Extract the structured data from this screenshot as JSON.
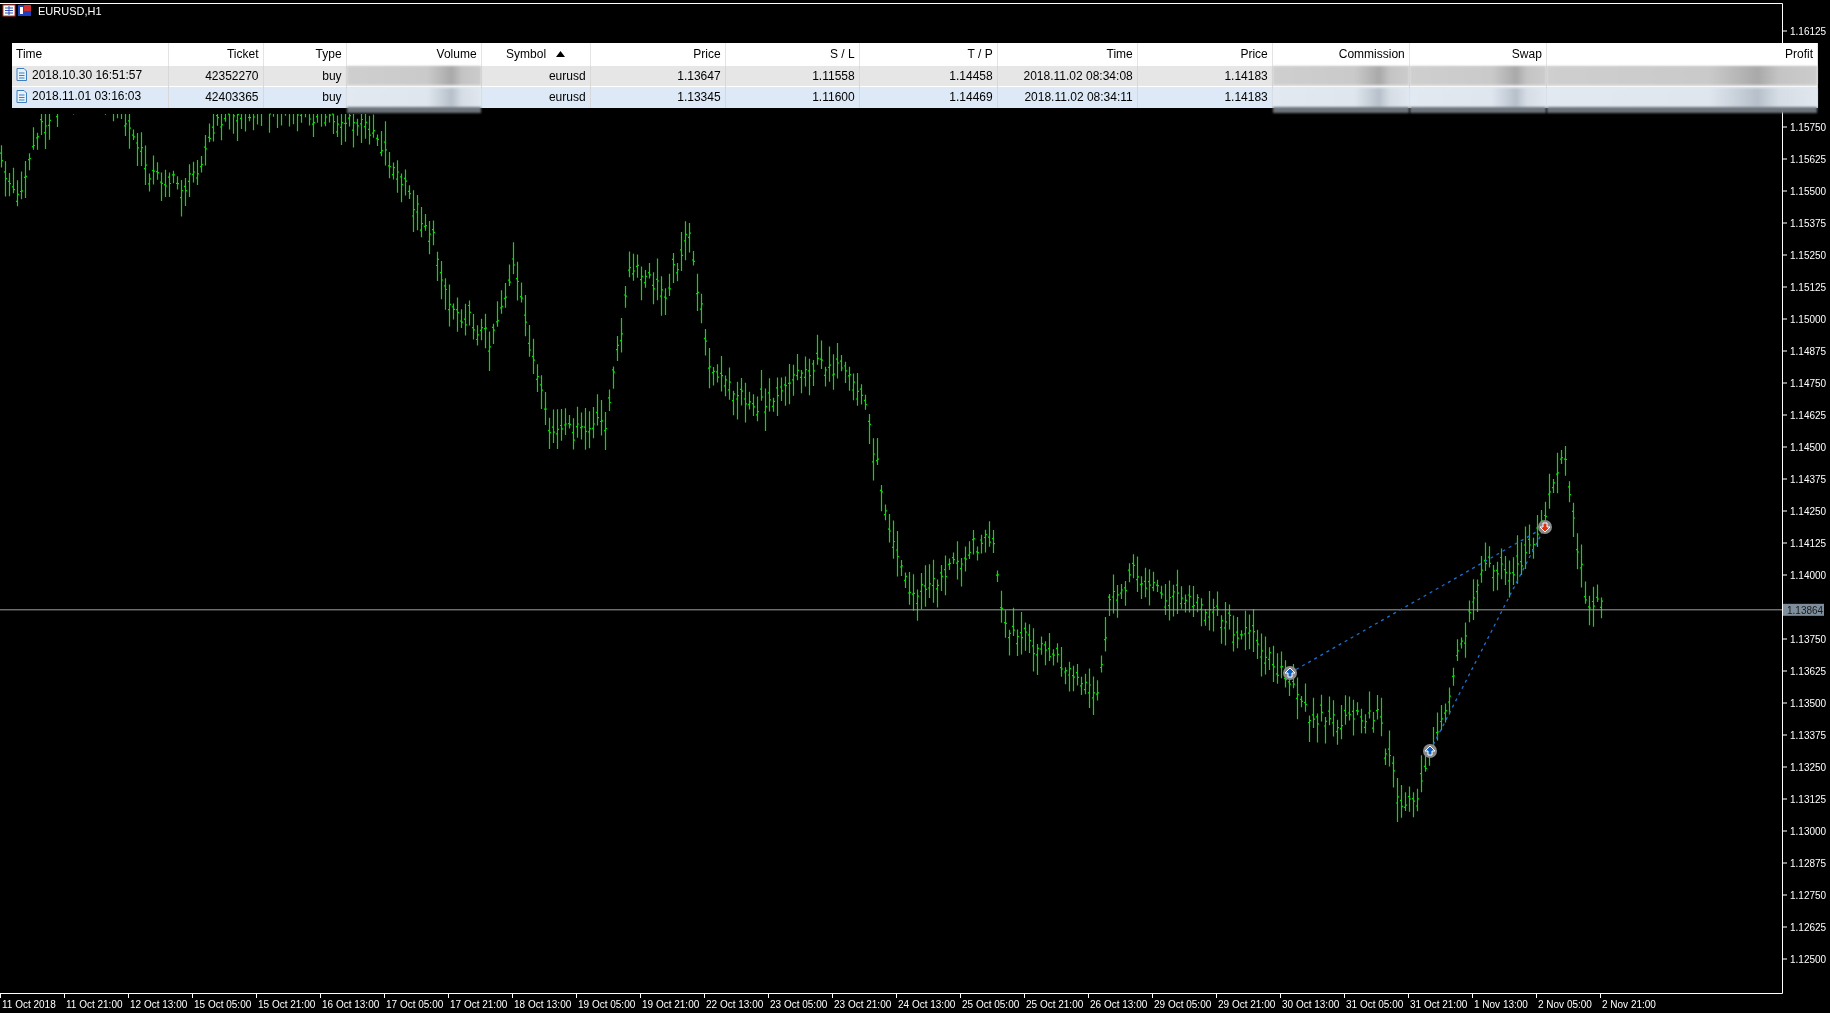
{
  "window": {
    "title": "EURUSD,H1"
  },
  "trades_table": {
    "columns": [
      {
        "label": "Time",
        "sorted": false
      },
      {
        "label": "Ticket",
        "sorted": false
      },
      {
        "label": "Type",
        "sorted": false
      },
      {
        "label": "Volume",
        "sorted": false
      },
      {
        "label": "Symbol",
        "sorted": true
      },
      {
        "label": "Price",
        "sorted": false
      },
      {
        "label": "S / L",
        "sorted": false
      },
      {
        "label": "T / P",
        "sorted": false
      },
      {
        "label": "Time",
        "sorted": false
      },
      {
        "label": "Price",
        "sorted": false
      },
      {
        "label": "Commission",
        "sorted": false
      },
      {
        "label": "Swap",
        "sorted": false
      },
      {
        "label": "Profit",
        "sorted": false
      }
    ],
    "rows": [
      {
        "selected": false,
        "cells": [
          "2018.10.30 16:51:57",
          "42352270",
          "buy",
          null,
          "eurusd",
          "1.13647",
          "1.11558",
          "1.14458",
          "2018.11.02 08:34:08",
          "1.14183",
          null,
          null,
          null
        ]
      },
      {
        "selected": true,
        "cells": [
          "2018.11.01 03:16:03",
          "42403365",
          "buy",
          null,
          "eurusd",
          "1.13345",
          "1.11600",
          "1.14469",
          "2018.11.02 08:34:11",
          "1.14183",
          null,
          null,
          null
        ]
      }
    ]
  },
  "price_axis": {
    "labels": [
      "1.16125",
      "1.15750",
      "1.15625",
      "1.15500",
      "1.15375",
      "1.15250",
      "1.15125",
      "1.15000",
      "1.14875",
      "1.14750",
      "1.14625",
      "1.14500",
      "1.14375",
      "1.14250",
      "1.14125",
      "1.14000",
      "1.13750",
      "1.13625",
      "1.13500",
      "1.13375",
      "1.13250",
      "1.13125",
      "1.13000",
      "1.12875",
      "1.12750",
      "1.12625",
      "1.12500"
    ],
    "current_price": "1.13864"
  },
  "time_axis": {
    "labels": [
      "11 Oct 2018",
      "11 Oct 21:00",
      "12 Oct 13:00",
      "15 Oct 05:00",
      "15 Oct 21:00",
      "16 Oct 13:00",
      "17 Oct 05:00",
      "17 Oct 21:00",
      "18 Oct 13:00",
      "19 Oct 05:00",
      "19 Oct 21:00",
      "22 Oct 13:00",
      "23 Oct 05:00",
      "23 Oct 21:00",
      "24 Oct 13:00",
      "25 Oct 05:00",
      "25 Oct 21:00",
      "26 Oct 13:00",
      "29 Oct 05:00",
      "29 Oct 21:00",
      "30 Oct 13:00",
      "31 Oct 05:00",
      "31 Oct 21:00",
      "1 Nov 13:00",
      "2 Nov 05:00",
      "2 Nov 21:00"
    ]
  }
}
